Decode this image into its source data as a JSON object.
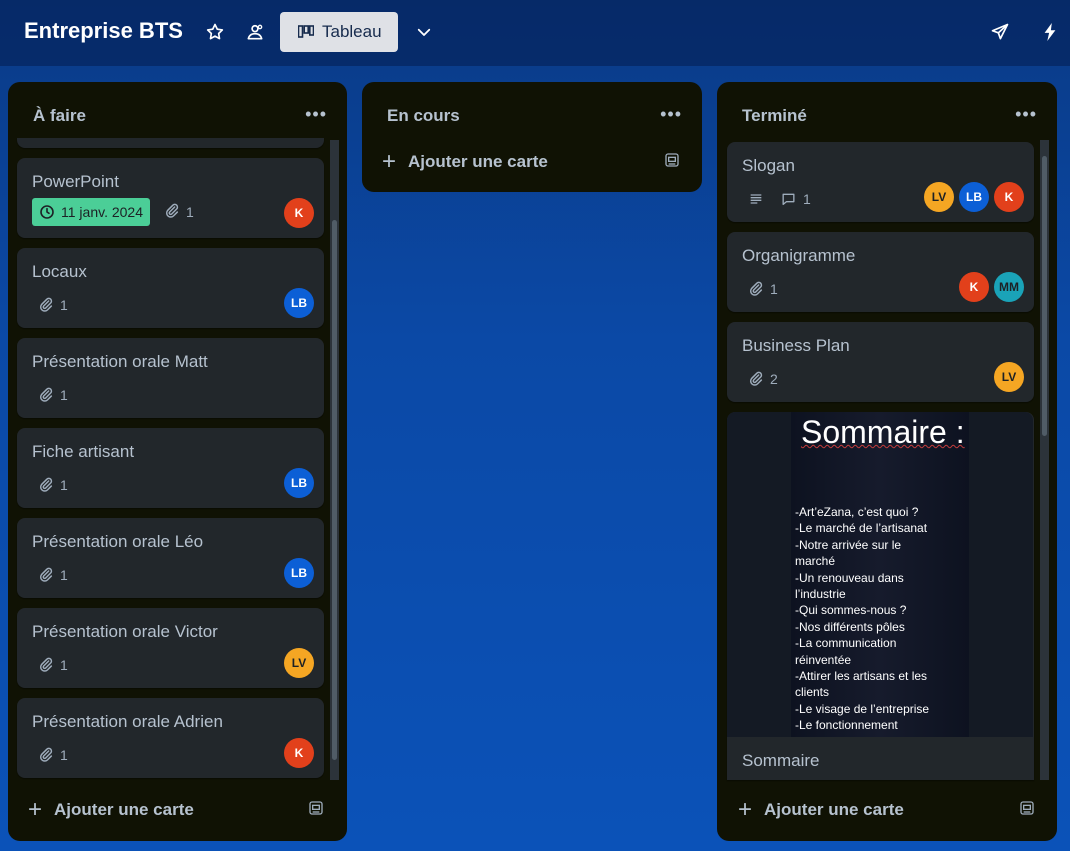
{
  "header": {
    "board_title": "Entreprise BTS",
    "view_label": "Tableau",
    "icons": [
      "star-icon",
      "workspace-visibility-icon",
      "board-view-icon",
      "chevron-down-icon",
      "send-icon",
      "power-up-icon"
    ]
  },
  "colors": {
    "date_badge": "#4bce97",
    "avatar_k": "#e2401b",
    "avatar_lb": "#0c5fd6",
    "avatar_lv": "#f5a623",
    "avatar_mm": "#1aa3b8"
  },
  "lists": [
    {
      "title": "À faire",
      "add_card_label": "Ajouter une carte",
      "cards": [
        {
          "title": "PowerPoint",
          "due_date": "11 janv. 2024",
          "attachments": "1",
          "members": [
            "K"
          ]
        },
        {
          "title": "Locaux",
          "attachments": "1",
          "members": [
            "LB"
          ]
        },
        {
          "title": "Présentation orale Matt",
          "attachments": "1",
          "members": []
        },
        {
          "title": "Fiche artisant",
          "attachments": "1",
          "members": [
            "LB"
          ]
        },
        {
          "title": "Présentation orale Léo",
          "attachments": "1",
          "members": [
            "LB"
          ]
        },
        {
          "title": "Présentation orale Victor",
          "attachments": "1",
          "members": [
            "LV"
          ]
        },
        {
          "title": "Présentation orale Adrien",
          "attachments": "1",
          "members": [
            "K"
          ]
        }
      ]
    },
    {
      "title": "En cours",
      "add_card_label": "Ajouter une carte",
      "cards": []
    },
    {
      "title": "Terminé",
      "add_card_label": "Ajouter une carte",
      "cards": [
        {
          "title": "Slogan",
          "comments": "1",
          "members": [
            "LV",
            "LB",
            "K"
          ]
        },
        {
          "title": "Organigramme",
          "attachments": "1",
          "members": [
            "K",
            "MM"
          ]
        },
        {
          "title": "Business Plan",
          "attachments": "2",
          "members": [
            "LV"
          ]
        },
        {
          "title": "Sommaire",
          "cover": {
            "heading": "Sommaire :",
            "lines": [
              "-Art’eZana, c’est quoi ?",
              "-Le marché de l’artisanat",
              "-Notre arrivée sur le",
              "marché",
              "-Un renouveau dans",
              "l’industrie",
              "-Qui sommes-nous ?",
              "-Nos différents pôles",
              "-La communication",
              "réinventée",
              "-Attirer les artisans et les",
              "clients",
              "-Le visage de l’entreprise",
              "-Le fonctionnement"
            ]
          }
        }
      ]
    }
  ]
}
